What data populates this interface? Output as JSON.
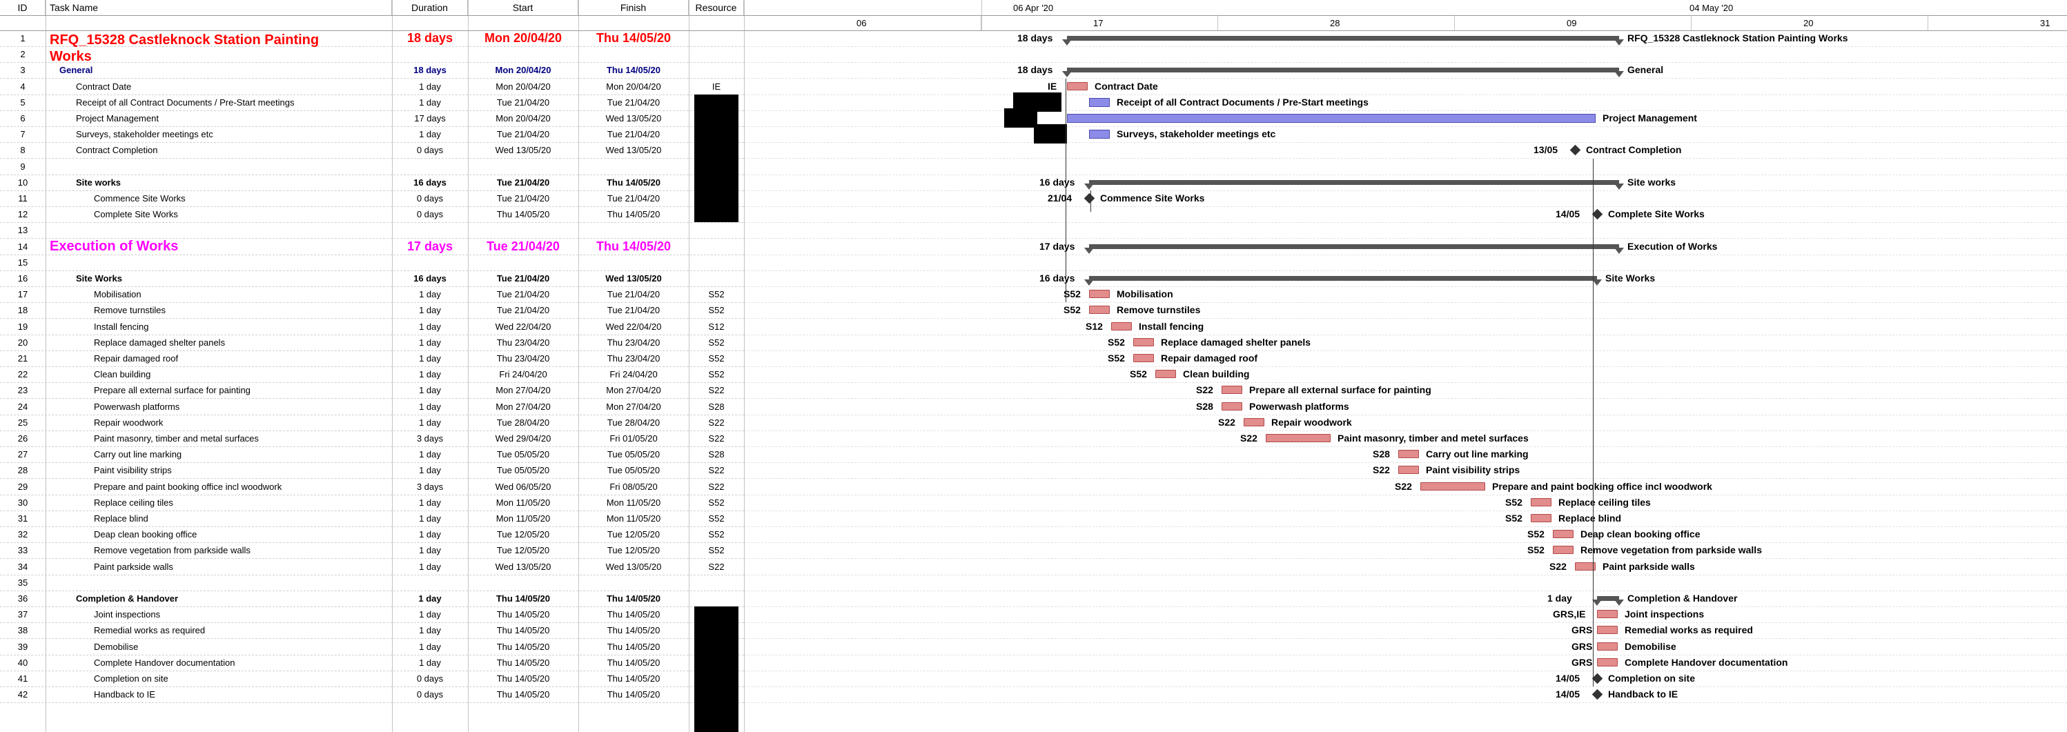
{
  "header": {
    "id": "ID",
    "task_name": "Task Name",
    "duration": "Duration",
    "start": "Start",
    "finish": "Finish",
    "resource": "Resource"
  },
  "timescale": {
    "major": [
      "06 Apr '20",
      "04 May '20"
    ],
    "minor": [
      "06",
      "17",
      "28",
      "09",
      "20",
      "31"
    ]
  },
  "colors": {
    "red": "#ff0000",
    "magenta": "#ff00ff",
    "navy": "#000080",
    "task_bar": "#e28c8c",
    "pm_bar": "#8c8ce8",
    "summary_bar": "#555555"
  },
  "rows": [
    {
      "id": "1",
      "name": "RFQ_15328 Castleknock Station Painting",
      "name2": "Works",
      "duration": "18 days",
      "start": "Mon 20/04/20",
      "finish": "Thu 14/05/20",
      "resource": "",
      "style": "title-red",
      "bar_label": "RFQ_15328 Castleknock Station Painting Works",
      "dur_label": "18 days"
    },
    {
      "id": "2",
      "name": "",
      "duration": "",
      "start": "",
      "finish": "",
      "resource": "",
      "style": "blank"
    },
    {
      "id": "3",
      "name": "General",
      "duration": "18 days",
      "start": "Mon 20/04/20",
      "finish": "Thu 14/05/20",
      "resource": "",
      "style": "sum-navy",
      "bar_label": "General",
      "dur_label": "18 days"
    },
    {
      "id": "4",
      "name": "Contract Date",
      "duration": "1 day",
      "start": "Mon 20/04/20",
      "finish": "Mon 20/04/20",
      "resource": "IE",
      "style": "task",
      "bar_label": "Contract Date",
      "res_label": "IE"
    },
    {
      "id": "5",
      "name": "Receipt of all Contract Documents / Pre-Start meetings",
      "duration": "1 day",
      "start": "Tue 21/04/20",
      "finish": "Tue 21/04/20",
      "resource": "",
      "style": "task",
      "bar_label": "Receipt of all Contract Documents / Pre-Start meetings"
    },
    {
      "id": "6",
      "name": "Project Management",
      "duration": "17 days",
      "start": "Mon 20/04/20",
      "finish": "Wed 13/05/20",
      "resource": "",
      "style": "task",
      "bar_label": "Project Management"
    },
    {
      "id": "7",
      "name": "Surveys, stakeholder meetings etc",
      "duration": "1 day",
      "start": "Tue 21/04/20",
      "finish": "Tue 21/04/20",
      "resource": "",
      "style": "task",
      "bar_label": "Surveys, stakeholder meetings etc"
    },
    {
      "id": "8",
      "name": "Contract Completion",
      "duration": "0 days",
      "start": "Wed 13/05/20",
      "finish": "Wed 13/05/20",
      "resource": "",
      "style": "task",
      "bar_label": "Contract Completion",
      "date_label": "13/05"
    },
    {
      "id": "9",
      "name": "",
      "duration": "",
      "start": "",
      "finish": "",
      "resource": "",
      "style": "blank"
    },
    {
      "id": "10",
      "name": "Site works",
      "duration": "16 days",
      "start": "Tue 21/04/20",
      "finish": "Thu 14/05/20",
      "resource": "",
      "style": "sum",
      "bar_label": "Site works",
      "dur_label": "16 days"
    },
    {
      "id": "11",
      "name": "Commence Site Works",
      "duration": "0 days",
      "start": "Tue 21/04/20",
      "finish": "Tue 21/04/20",
      "resource": "",
      "style": "task2",
      "bar_label": "Commence Site Works",
      "date_label": "21/04"
    },
    {
      "id": "12",
      "name": "Complete Site Works",
      "duration": "0 days",
      "start": "Thu 14/05/20",
      "finish": "Thu 14/05/20",
      "resource": "",
      "style": "task2",
      "bar_label": "Complete Site Works",
      "date_label": "14/05"
    },
    {
      "id": "13",
      "name": "",
      "duration": "",
      "start": "",
      "finish": "",
      "resource": "",
      "style": "blank"
    },
    {
      "id": "14",
      "name": "Execution of Works",
      "duration": "17 days",
      "start": "Tue 21/04/20",
      "finish": "Thu 14/05/20",
      "resource": "",
      "style": "title-mag",
      "bar_label": "Execution of Works",
      "dur_label": "17 days"
    },
    {
      "id": "15",
      "name": "",
      "duration": "",
      "start": "",
      "finish": "",
      "resource": "",
      "style": "blank"
    },
    {
      "id": "16",
      "name": "Site Works",
      "duration": "16 days",
      "start": "Tue 21/04/20",
      "finish": "Wed 13/05/20",
      "resource": "",
      "style": "sum",
      "bar_label": "Site Works",
      "dur_label": "16 days"
    },
    {
      "id": "17",
      "name": "Mobilisation",
      "duration": "1 day",
      "start": "Tue 21/04/20",
      "finish": "Tue 21/04/20",
      "resource": "S52",
      "style": "task2",
      "bar_label": "Mobilisation",
      "res_label": "S52"
    },
    {
      "id": "18",
      "name": "Remove turnstiles",
      "duration": "1 day",
      "start": "Tue 21/04/20",
      "finish": "Tue 21/04/20",
      "resource": "S52",
      "style": "task2",
      "bar_label": "Remove turnstiles",
      "res_label": "S52"
    },
    {
      "id": "19",
      "name": "Install fencing",
      "duration": "1 day",
      "start": "Wed 22/04/20",
      "finish": "Wed 22/04/20",
      "resource": "S12",
      "style": "task2",
      "bar_label": "Install fencing",
      "res_label": "S12"
    },
    {
      "id": "20",
      "name": "Replace damaged shelter panels",
      "duration": "1 day",
      "start": "Thu 23/04/20",
      "finish": "Thu 23/04/20",
      "resource": "S52",
      "style": "task2",
      "bar_label": "Replace damaged shelter panels",
      "res_label": "S52"
    },
    {
      "id": "21",
      "name": "Repair damaged roof",
      "duration": "1 day",
      "start": "Thu 23/04/20",
      "finish": "Thu 23/04/20",
      "resource": "S52",
      "style": "task2",
      "bar_label": "Repair damaged roof",
      "res_label": "S52"
    },
    {
      "id": "22",
      "name": "Clean building",
      "duration": "1 day",
      "start": "Fri 24/04/20",
      "finish": "Fri 24/04/20",
      "resource": "S52",
      "style": "task2",
      "bar_label": "Clean building",
      "res_label": "S52"
    },
    {
      "id": "23",
      "name": "Prepare all external surface for painting",
      "duration": "1 day",
      "start": "Mon 27/04/20",
      "finish": "Mon 27/04/20",
      "resource": "S22",
      "style": "task2",
      "bar_label": "Prepare all external surface for painting",
      "res_label": "S22"
    },
    {
      "id": "24",
      "name": "Powerwash platforms",
      "duration": "1 day",
      "start": "Mon 27/04/20",
      "finish": "Mon 27/04/20",
      "resource": "S28",
      "style": "task2",
      "bar_label": "Powerwash platforms",
      "res_label": "S28"
    },
    {
      "id": "25",
      "name": "Repair woodwork",
      "duration": "1 day",
      "start": "Tue 28/04/20",
      "finish": "Tue 28/04/20",
      "resource": "S22",
      "style": "task2",
      "bar_label": "Repair woodwork",
      "res_label": "S22"
    },
    {
      "id": "26",
      "name": "Paint masonry, timber and metal surfaces",
      "duration": "3 days",
      "start": "Wed 29/04/20",
      "finish": "Fri 01/05/20",
      "resource": "S22",
      "style": "task2",
      "bar_label": "Paint masonry, timber and metel surfaces",
      "res_label": "S22"
    },
    {
      "id": "27",
      "name": "Carry out line marking",
      "duration": "1 day",
      "start": "Tue 05/05/20",
      "finish": "Tue 05/05/20",
      "resource": "S28",
      "style": "task2",
      "bar_label": "Carry out line marking",
      "res_label": "S28"
    },
    {
      "id": "28",
      "name": "Paint visibility strips",
      "duration": "1 day",
      "start": "Tue 05/05/20",
      "finish": "Tue 05/05/20",
      "resource": "S22",
      "style": "task2",
      "bar_label": "Paint visibility strips",
      "res_label": "S22"
    },
    {
      "id": "29",
      "name": "Prepare and paint booking office incl woodwork",
      "duration": "3 days",
      "start": "Wed 06/05/20",
      "finish": "Fri 08/05/20",
      "resource": "S22",
      "style": "task2",
      "bar_label": "Prepare and paint booking office incl woodwork",
      "res_label": "S22"
    },
    {
      "id": "30",
      "name": "Replace ceiling tiles",
      "duration": "1 day",
      "start": "Mon 11/05/20",
      "finish": "Mon 11/05/20",
      "resource": "S52",
      "style": "task2",
      "bar_label": "Replace ceiling tiles",
      "res_label": "S52"
    },
    {
      "id": "31",
      "name": "Replace blind",
      "duration": "1 day",
      "start": "Mon 11/05/20",
      "finish": "Mon 11/05/20",
      "resource": "S52",
      "style": "task2",
      "bar_label": "Replace blind",
      "res_label": "S52"
    },
    {
      "id": "32",
      "name": "Deap clean booking office",
      "duration": "1 day",
      "start": "Tue 12/05/20",
      "finish": "Tue 12/05/20",
      "resource": "S52",
      "style": "task2",
      "bar_label": "Deap clean booking office",
      "res_label": "S52"
    },
    {
      "id": "33",
      "name": "Remove vegetation from parkside walls",
      "duration": "1 day",
      "start": "Tue 12/05/20",
      "finish": "Tue 12/05/20",
      "resource": "S52",
      "style": "task2",
      "bar_label": "Remove vegetation from parkside walls",
      "res_label": "S52"
    },
    {
      "id": "34",
      "name": "Paint parkside walls",
      "duration": "1 day",
      "start": "Wed 13/05/20",
      "finish": "Wed 13/05/20",
      "resource": "S22",
      "style": "task2",
      "bar_label": "Paint parkside walls",
      "res_label": "S22"
    },
    {
      "id": "35",
      "name": "",
      "duration": "",
      "start": "",
      "finish": "",
      "resource": "",
      "style": "blank"
    },
    {
      "id": "36",
      "name": "Completion & Handover",
      "duration": "1 day",
      "start": "Thu 14/05/20",
      "finish": "Thu 14/05/20",
      "resource": "",
      "style": "sum",
      "bar_label": "Completion & Handover",
      "dur_label": "1 day"
    },
    {
      "id": "37",
      "name": "Joint inspections",
      "duration": "1 day",
      "start": "Thu 14/05/20",
      "finish": "Thu 14/05/20",
      "resource": "",
      "style": "task2",
      "bar_label": "Joint inspections",
      "res_label": "GRS,IE"
    },
    {
      "id": "38",
      "name": "Remedial works as required",
      "duration": "1 day",
      "start": "Thu 14/05/20",
      "finish": "Thu 14/05/20",
      "resource": "",
      "style": "task2",
      "bar_label": "Remedial works as required",
      "res_label": "GRS"
    },
    {
      "id": "39",
      "name": "Demobilise",
      "duration": "1 day",
      "start": "Thu 14/05/20",
      "finish": "Thu 14/05/20",
      "resource": "",
      "style": "task2",
      "bar_label": "Demobilise",
      "res_label": "GRS"
    },
    {
      "id": "40",
      "name": "Complete Handover documentation",
      "duration": "1 day",
      "start": "Thu 14/05/20",
      "finish": "Thu 14/05/20",
      "resource": "",
      "style": "task2",
      "bar_label": "Complete Handover documentation",
      "res_label": "GRS"
    },
    {
      "id": "41",
      "name": "Completion on site",
      "duration": "0 days",
      "start": "Thu 14/05/20",
      "finish": "Thu 14/05/20",
      "resource": "",
      "style": "task2",
      "bar_label": "Completion on site",
      "date_label": "14/05"
    },
    {
      "id": "42",
      "name": "Handback to IE",
      "duration": "0 days",
      "start": "Thu 14/05/20",
      "finish": "Thu 14/05/20",
      "resource": "",
      "style": "task2",
      "bar_label": "Handback to IE",
      "date_label": "14/05"
    }
  ]
}
